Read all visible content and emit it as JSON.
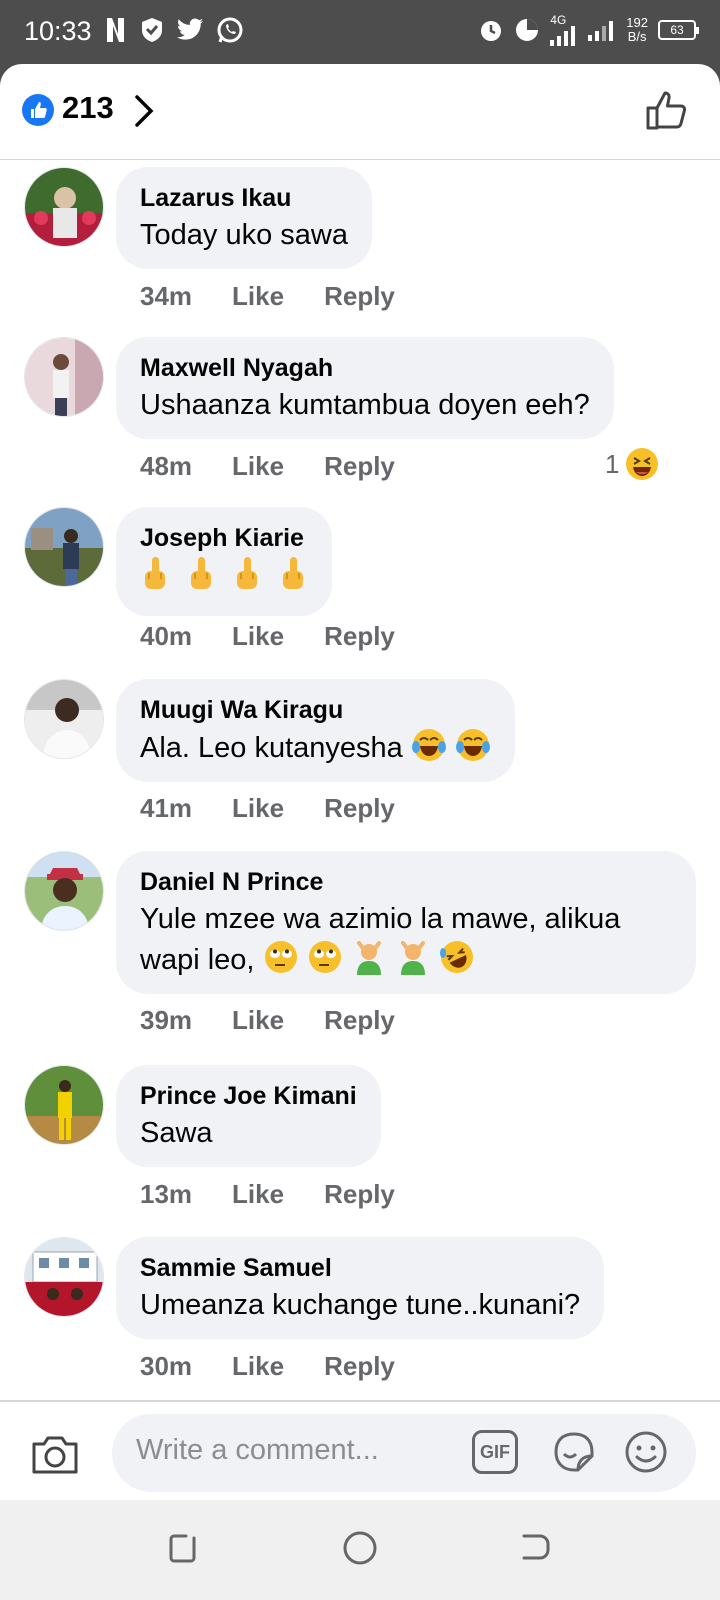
{
  "status": {
    "time": "10:33",
    "network_label": "4G",
    "speed_top": "192",
    "speed_bottom": "B/s",
    "battery": "63"
  },
  "header": {
    "like_count": "213"
  },
  "comments": [
    {
      "name": "Lazarus Ikau",
      "text": "Today uko sawa",
      "time": "34m",
      "like": "Like",
      "reply": "Reply"
    },
    {
      "name": "Maxwell Nyagah",
      "text": "Ushaanza kumtambua doyen eeh?",
      "time": "48m",
      "like": "Like",
      "reply": "Reply",
      "reactions": "1"
    },
    {
      "name": "Joseph Kiarie",
      "text": "",
      "time": "40m",
      "like": "Like",
      "reply": "Reply"
    },
    {
      "name": "Muugi Wa Kiragu",
      "text": "Ala. Leo kutanyesha",
      "time": "41m",
      "like": "Like",
      "reply": "Reply"
    },
    {
      "name": "Daniel N Prince",
      "text": "Yule mzee wa azimio la mawe,  alikua wapi leo,",
      "time": "39m",
      "like": "Like",
      "reply": "Reply"
    },
    {
      "name": "Prince Joe Kimani",
      "text": "Sawa",
      "time": "13m",
      "like": "Like",
      "reply": "Reply"
    },
    {
      "name": "Sammie Samuel",
      "text": "Umeanza kuchange tune..kunani?",
      "time": "30m",
      "like": "Like",
      "reply": "Reply"
    }
  ],
  "composer": {
    "placeholder": "Write a comment...",
    "gif_label": "GIF"
  },
  "colors": {
    "accent": "#1877f2",
    "bubble": "#f0f2f5",
    "meta": "#65676b",
    "statusbar": "#4d4d4d"
  }
}
